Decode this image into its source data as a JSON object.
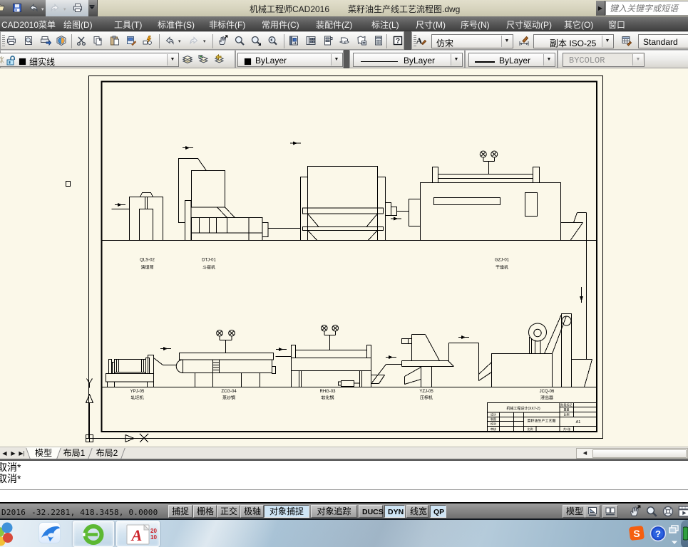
{
  "window": {
    "app_title": "机械工程师CAD2016",
    "doc_title": "菜籽油生产线工艺流程图.dwg",
    "search_placeholder": "键入关键字或短语"
  },
  "menu": {
    "items": [
      "CAD2010菜单",
      "绘图(D)",
      "工具(T)",
      "标准件(S)",
      "非标件(F)",
      "常用件(C)",
      "装配件(Z)",
      "标注(L)",
      "尺寸(M)",
      "序号(N)",
      "尺寸驱动(P)",
      "其它(O)",
      "窗口"
    ]
  },
  "toolbars": {
    "text_style": "仿宋",
    "dim_style": "副本 ISO-25",
    "table_style": "Standard",
    "layer": "细实线",
    "color": "ByLayer",
    "linetype": "ByLayer",
    "lineweight": "ByLayer",
    "plot_style": "BYCOLOR"
  },
  "drawing": {
    "labels_top": [
      {
        "code": "QLS-02",
        "name": "清理筛"
      },
      {
        "code": "DTJ-01",
        "name": "斗提机"
      },
      {
        "code": "GZJ-01",
        "name": "干燥机"
      }
    ],
    "labels_bottom": [
      {
        "code": "YPJ-05",
        "name": "轧坯机"
      },
      {
        "code": "ZCG-04",
        "name": "蒸炒锅"
      },
      {
        "code": "RHG-03",
        "name": "软化锅"
      },
      {
        "code": "YZJ-05",
        "name": "压榨机"
      },
      {
        "code": "JCQ-06",
        "name": "浸出器"
      }
    ],
    "title_block": {
      "project": "机械工程设计(XX7-2)",
      "title": "菜籽油生产工艺图",
      "sheet_size": "A1",
      "right_rows": [
        "阶段标记",
        "重量",
        "比例"
      ],
      "left_rows": [
        "设计",
        "制图",
        "校对",
        "审核"
      ],
      "scale_label": "比例",
      "sheets": "共1张"
    }
  },
  "tabs": {
    "items": [
      "模型",
      "布局1",
      "布局2"
    ]
  },
  "command": {
    "history": [
      "取消*",
      "取消*"
    ]
  },
  "status": {
    "left": "D2016",
    "coords": "-32.2281,  418.3458,  0.0000",
    "toggles": [
      {
        "label": "捕捉",
        "pressed": false
      },
      {
        "label": "栅格",
        "pressed": false
      },
      {
        "label": "正交",
        "pressed": false
      },
      {
        "label": "极轴",
        "pressed": false
      },
      {
        "label": "对象捕捉",
        "pressed": true
      },
      {
        "label": "对象追踪",
        "pressed": false
      },
      {
        "label": "DUCS",
        "pressed": false
      },
      {
        "label": "DYN",
        "pressed": true
      },
      {
        "label": "线宽",
        "pressed": false
      },
      {
        "label": "QP",
        "pressed": true
      }
    ],
    "model_button": "模型"
  }
}
